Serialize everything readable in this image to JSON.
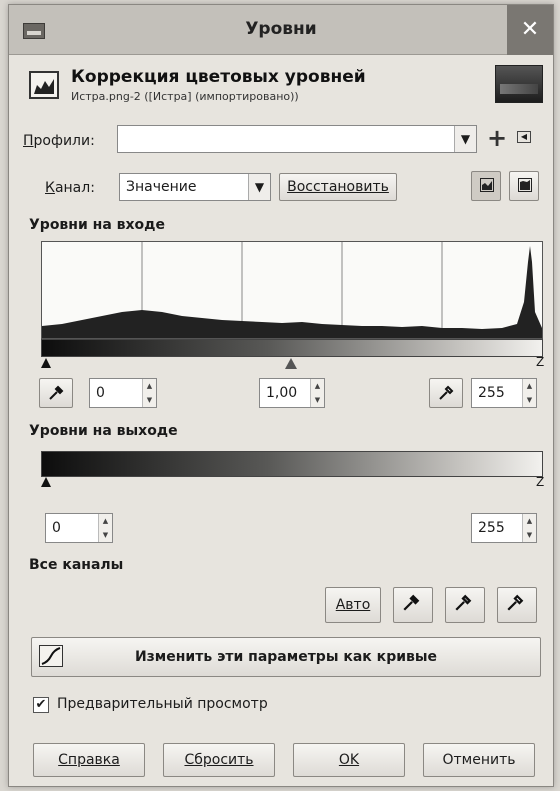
{
  "window": {
    "title": "Уровни",
    "close_glyph": "✕"
  },
  "header": {
    "title": "Коррекция цветовых уровней",
    "subtitle": "Истра.png-2 ([Истра] (импортировано))"
  },
  "profiles": {
    "label_u": "П",
    "label_rest": "рофили:",
    "value": ""
  },
  "channel": {
    "label_u": "К",
    "label_rest": "анал:",
    "value": "Значение",
    "reset_label": "Восстановить"
  },
  "input_levels": {
    "title": "Уровни на входе",
    "black": "0",
    "gamma": "1,00",
    "white": "255"
  },
  "output_levels": {
    "title": "Уровни на выходе",
    "black": "0",
    "white": "255"
  },
  "all_channels": {
    "title": "Все каналы",
    "auto_label": "Авто"
  },
  "curves_button": "Изменить эти параметры как кривые",
  "preview": {
    "checked": true,
    "label": "Предварительный просмотр"
  },
  "footer": {
    "help": "Справка",
    "reset": "Сбросить",
    "ok": "OK",
    "cancel": "Отменить"
  },
  "colors": {
    "background": "#e7e4de",
    "titlebar": "#c3c0ba",
    "close": "#7a7772"
  }
}
